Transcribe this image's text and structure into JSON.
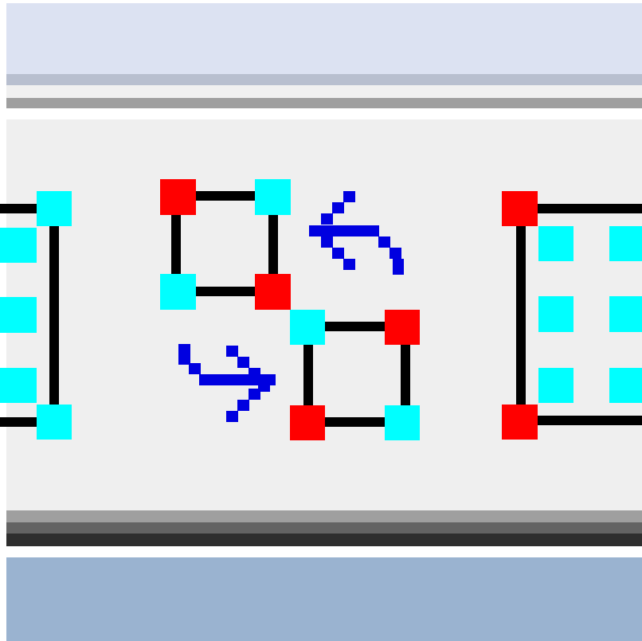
{
  "window": {
    "title_bar_color": "#dce2f2",
    "status_band_color": "#9ab3d0",
    "toolbar_color": "#efefef"
  },
  "toolbar": {
    "buttons": [
      {
        "name": "align-left-edge",
        "icon": "node-square-left-partial-icon",
        "state": "normal"
      },
      {
        "name": "swap-nodes",
        "icon": "swap-node-squares-icon",
        "state": "normal"
      },
      {
        "name": "align-right-edge",
        "icon": "node-rectangle-right-partial-icon",
        "state": "normal"
      }
    ]
  },
  "colors": {
    "corner_node": "#ff0000",
    "handle_node": "#00ffff",
    "arrow": "#0000e0",
    "edge": "#000000"
  }
}
